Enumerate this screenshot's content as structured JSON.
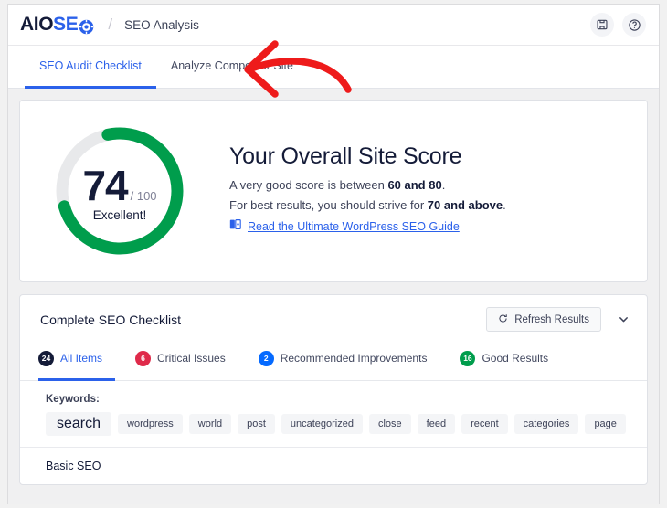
{
  "header": {
    "logo": {
      "part1": "AIO",
      "part2": "SE",
      "icon": "gear-globe-icon"
    },
    "separator": "/",
    "breadcrumb": "SEO Analysis",
    "notes_icon": "notes-icon",
    "help_icon": "help-circle-icon"
  },
  "tabs": [
    {
      "label": "SEO Audit Checklist",
      "active": true
    },
    {
      "label": "Analyze Competitor Site",
      "active": false
    }
  ],
  "annotation": {
    "type": "red-arrow",
    "color": "#ee1b1b",
    "points_to": "Analyze Competitor Site"
  },
  "score": {
    "value": "74",
    "out_of": "/ 100",
    "rating": "Excellent!",
    "percent": 74,
    "arc_color": "#009d4c",
    "track_color": "#e8e9eb",
    "title": "Your Overall Site Score",
    "line1_pre": "A very good score is between ",
    "line1_bold": "60 and 80",
    "line1_post": ".",
    "line2_pre": "For best results, you should strive for ",
    "line2_bold": "70 and above",
    "line2_post": ".",
    "guide_icon": "book-icon",
    "guide_link": "Read the Ultimate WordPress SEO Guide"
  },
  "checklist": {
    "title": "Complete SEO Checklist",
    "refresh_icon": "refresh-icon",
    "refresh_label": "Refresh Results",
    "collapse_icon": "chevron-down-icon",
    "filters": [
      {
        "count": "24",
        "label": "All Items",
        "color": "#141b38",
        "active": true
      },
      {
        "count": "6",
        "label": "Critical Issues",
        "color": "#df2a4a",
        "active": false
      },
      {
        "count": "2",
        "label": "Recommended Improvements",
        "color": "#056aff",
        "active": false
      },
      {
        "count": "16",
        "label": "Good Results",
        "color": "#009d4c",
        "active": false
      }
    ],
    "keywords_label": "Keywords:",
    "keywords": [
      {
        "text": "search",
        "lead": true
      },
      {
        "text": "wordpress",
        "lead": false
      },
      {
        "text": "world",
        "lead": false
      },
      {
        "text": "post",
        "lead": false
      },
      {
        "text": "uncategorized",
        "lead": false
      },
      {
        "text": "close",
        "lead": false
      },
      {
        "text": "feed",
        "lead": false
      },
      {
        "text": "recent",
        "lead": false
      },
      {
        "text": "categories",
        "lead": false
      },
      {
        "text": "page",
        "lead": false
      }
    ],
    "sections": [
      {
        "label": "Basic SEO"
      }
    ]
  }
}
